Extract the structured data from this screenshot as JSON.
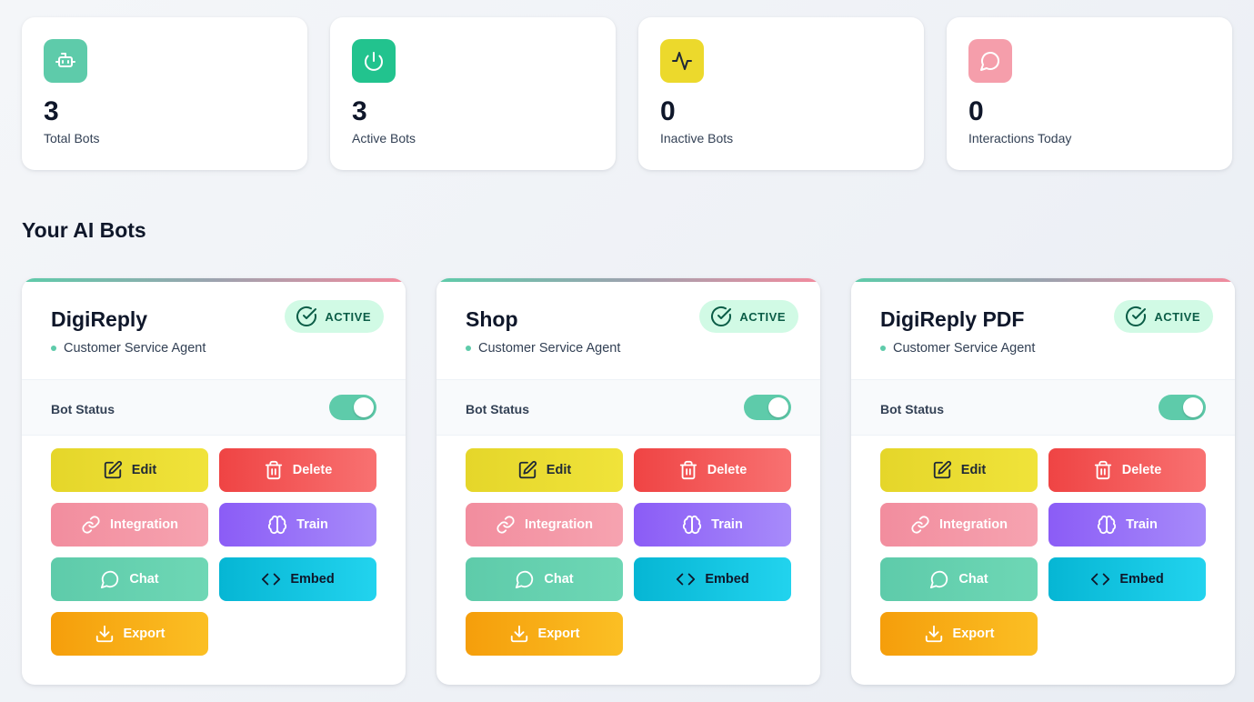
{
  "stats": [
    {
      "icon": "bot-icon",
      "color": "#5ecbaa",
      "value": "3",
      "label": "Total Bots"
    },
    {
      "icon": "power-icon",
      "color": "#22c38e",
      "value": "3",
      "label": "Active Bots"
    },
    {
      "icon": "activity-icon",
      "color": "#ecd92c",
      "value": "0",
      "label": "Inactive Bots"
    },
    {
      "icon": "message-circle-icon",
      "color": "#f59eab",
      "value": "0",
      "label": "Interactions Today"
    }
  ],
  "section_title": "Your AI Bots",
  "bots": [
    {
      "name": "DigiReply",
      "role": "Customer Service Agent",
      "status_badge": "ACTIVE",
      "status_label": "Bot Status",
      "enabled": true
    },
    {
      "name": "Shop",
      "role": "Customer Service Agent",
      "status_badge": "ACTIVE",
      "status_label": "Bot Status",
      "enabled": true
    },
    {
      "name": "DigiReply PDF",
      "role": "Customer Service Agent",
      "status_badge": "ACTIVE",
      "status_label": "Bot Status",
      "enabled": true
    }
  ],
  "actions": {
    "edit": "Edit",
    "delete": "Delete",
    "integration": "Integration",
    "train": "Train",
    "chat": "Chat",
    "embed": "Embed",
    "export": "Export"
  },
  "colors": {
    "accent_green": "#5ecbaa",
    "active_badge_bg": "#d1fae5",
    "active_badge_text": "#0b5d47"
  }
}
